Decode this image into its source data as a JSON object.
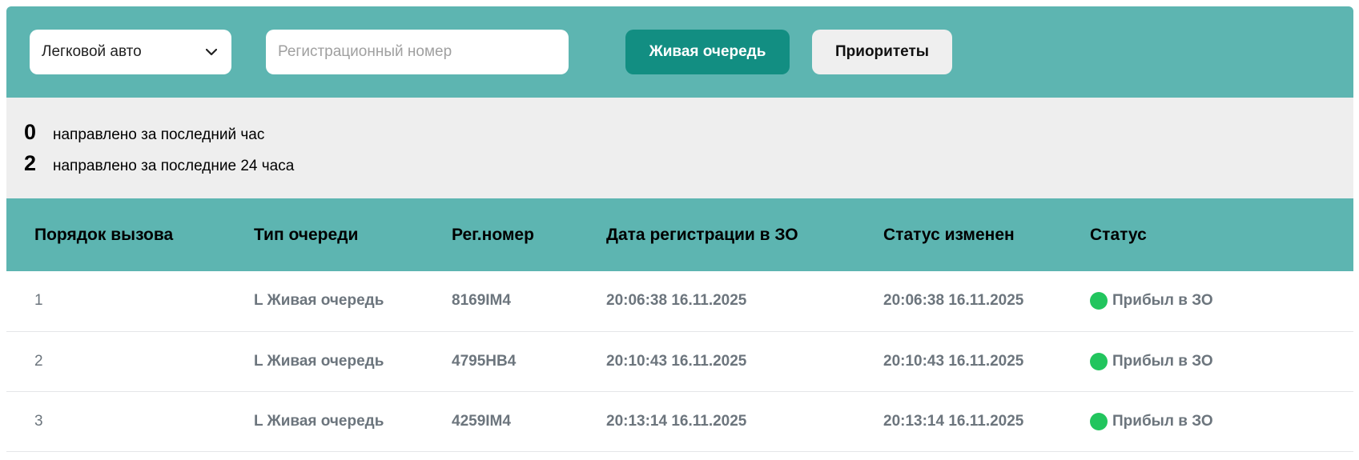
{
  "toolbar": {
    "vehicle_select": {
      "value": "Легковой авто",
      "icon": "chevron-down-icon"
    },
    "search": {
      "placeholder": "Регистрационный номер",
      "value": ""
    },
    "live_queue_label": "Живая очередь",
    "priorities_label": "Приоритеты"
  },
  "stats": [
    {
      "count": "0",
      "label": "направлено за последний час"
    },
    {
      "count": "2",
      "label": "направлено за последние 24 часа"
    }
  ],
  "table": {
    "columns": [
      "Порядок вызова",
      "Тип очереди",
      "Рег.номер",
      "Дата регистрации в ЗО",
      "Статус изменен",
      "Статус"
    ],
    "rows": [
      {
        "order": "1",
        "queue_type": "L Живая очередь",
        "reg_number": "8169IM4",
        "registered": "20:06:38 16.11.2025",
        "changed": "20:06:38 16.11.2025",
        "status": "Прибыл в ЗО"
      },
      {
        "order": "2",
        "queue_type": "L Живая очередь",
        "reg_number": "4795HB4",
        "registered": "20:10:43 16.11.2025",
        "changed": "20:10:43 16.11.2025",
        "status": "Прибыл в ЗО"
      },
      {
        "order": "3",
        "queue_type": "L Живая очередь",
        "reg_number": "4259IM4",
        "registered": "20:13:14 16.11.2025",
        "changed": "20:13:14 16.11.2025",
        "status": "Прибыл в ЗО"
      }
    ]
  },
  "colors": {
    "header_teal": "#5db5b1",
    "button_teal": "#128e82",
    "status_green": "#22c55e"
  }
}
